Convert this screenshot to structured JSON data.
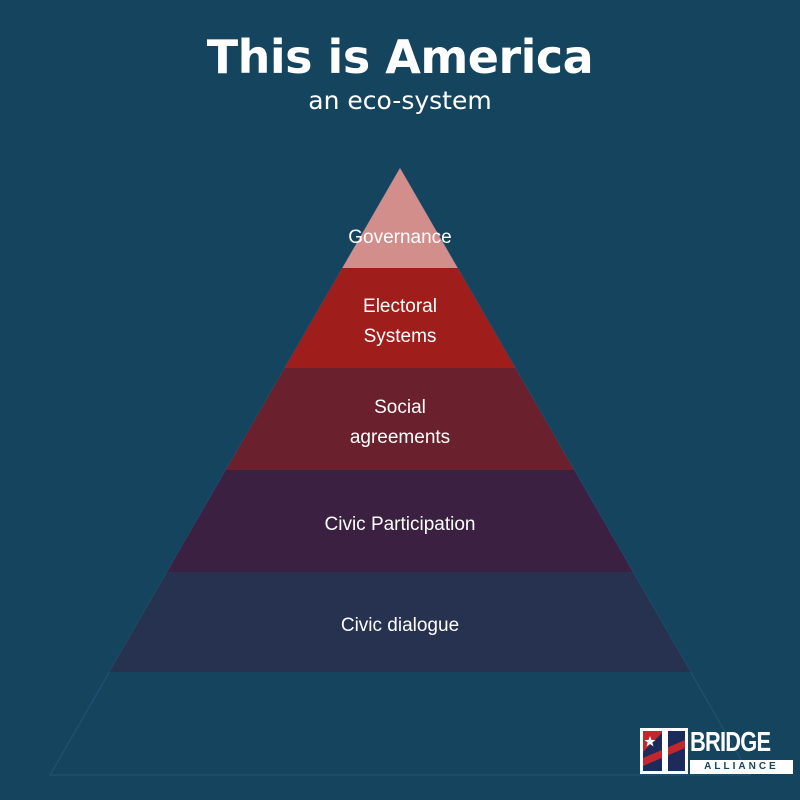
{
  "header": {
    "title": "This is America",
    "subtitle": "an eco-system"
  },
  "pyramid": {
    "tiers": [
      {
        "lines": [
          "Governance"
        ],
        "color": "#d18e8a"
      },
      {
        "lines": [
          "Electoral",
          "Systems"
        ],
        "color": "#9f1e1c"
      },
      {
        "lines": [
          "Social",
          "agreements"
        ],
        "color": "#6a202d"
      },
      {
        "lines": [
          "Civic Participation"
        ],
        "color": "#3b2042"
      },
      {
        "lines": [
          "Civic dialogue"
        ],
        "color": "#26324f"
      }
    ],
    "outline_color": "#1f5675"
  },
  "logo": {
    "word": "BRIDGE",
    "sub": "ALLIANCE",
    "colors": {
      "red": "#c1272d",
      "navy": "#1c2b5a",
      "white": "#ffffff"
    }
  },
  "colors": {
    "background": "#15445f",
    "text": "#ffffff"
  }
}
